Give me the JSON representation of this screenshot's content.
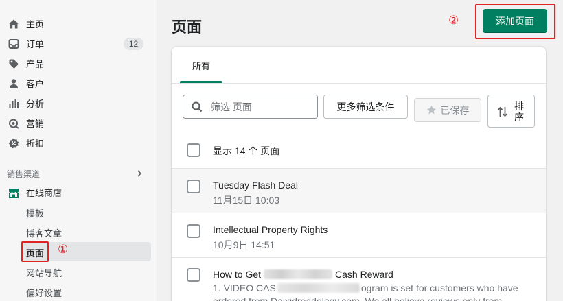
{
  "sidebar": {
    "items": [
      {
        "name": "home",
        "label": "主页",
        "icon": "home-icon"
      },
      {
        "name": "orders",
        "label": "订单",
        "icon": "inbox-icon",
        "badge": "12"
      },
      {
        "name": "products",
        "label": "产品",
        "icon": "tag-icon"
      },
      {
        "name": "customers",
        "label": "客户",
        "icon": "person-icon"
      },
      {
        "name": "analytics",
        "label": "分析",
        "icon": "bar-chart-icon"
      },
      {
        "name": "marketing",
        "label": "营销",
        "icon": "target-icon"
      },
      {
        "name": "discounts",
        "label": "折扣",
        "icon": "discount-icon"
      }
    ],
    "sales_channels_label": "销售渠道",
    "online_store": {
      "label": "在线商店",
      "icon": "store-icon"
    },
    "sub_items": [
      {
        "name": "themes",
        "label": "模板"
      },
      {
        "name": "blog-posts",
        "label": "博客文章"
      },
      {
        "name": "pages",
        "label": "页面",
        "active": true
      },
      {
        "name": "navigation",
        "label": "网站导航"
      },
      {
        "name": "preferences",
        "label": "偏好设置"
      }
    ],
    "annotation_1": "①"
  },
  "header": {
    "title": "页面",
    "add_button": "添加页面",
    "annotation_2": "②"
  },
  "card": {
    "tab_all": "所有",
    "search_placeholder": "筛选 页面",
    "more_filters": "更多筛选条件",
    "saved": "已保存",
    "sort_line1": "排",
    "sort_line2": "序",
    "count_label": "显示 14 个 页面",
    "rows": [
      {
        "title": "Tuesday Flash Deal",
        "date": "11月15日 10:03"
      },
      {
        "title": "Intellectual Property Rights",
        "date": "10月9日 14:51"
      },
      {
        "title_pre": "How to Get",
        "title_post": "Cash Reward",
        "desc_pre": "1. VIDEO CAS",
        "desc_post": "ogram is set for customers who have",
        "desc_line2": "ordered from Daixidreadology.com. We all believe reviews only from"
      }
    ]
  },
  "colors": {
    "primary": "#008060",
    "annotation": "#e02424",
    "sidebar_bg": "#f6f6f7"
  }
}
